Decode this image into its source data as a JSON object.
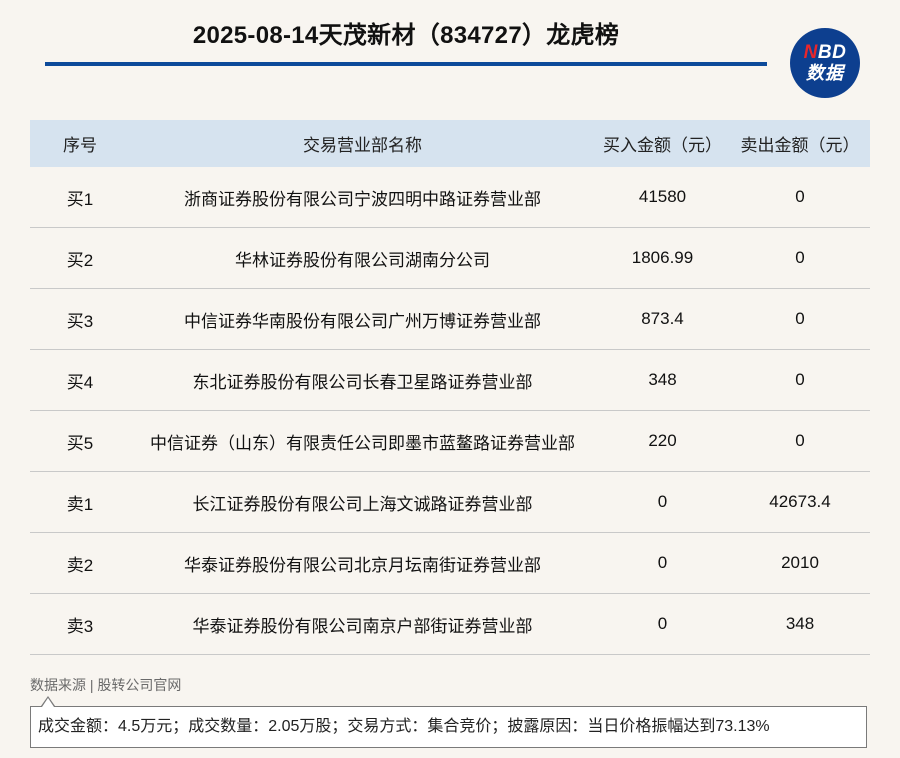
{
  "header": {
    "title": "2025-08-14天茂新材（834727）龙虎榜",
    "logo_line1_accent": "N",
    "logo_line1_rest": "BD",
    "logo_line2": "数据",
    "logo_colors": {
      "background": "#0d3f8f",
      "accent": "#e8262b"
    }
  },
  "table": {
    "columns": [
      "序号",
      "交易营业部名称",
      "买入金额（元）",
      "卖出金额（元）"
    ],
    "rows": [
      {
        "no": "买1",
        "name": "浙商证券股份有限公司宁波四明中路证券营业部",
        "buy": "41580",
        "sell": "0"
      },
      {
        "no": "买2",
        "name": "华林证券股份有限公司湖南分公司",
        "buy": "1806.99",
        "sell": "0"
      },
      {
        "no": "买3",
        "name": "中信证券华南股份有限公司广州万博证券营业部",
        "buy": "873.4",
        "sell": "0"
      },
      {
        "no": "买4",
        "name": "东北证券股份有限公司长春卫星路证券营业部",
        "buy": "348",
        "sell": "0"
      },
      {
        "no": "买5",
        "name": "中信证券（山东）有限责任公司即墨市蓝鳌路证券营业部",
        "buy": "220",
        "sell": "0"
      },
      {
        "no": "卖1",
        "name": "长江证券股份有限公司上海文诚路证券营业部",
        "buy": "0",
        "sell": "42673.4"
      },
      {
        "no": "卖2",
        "name": "华泰证券股份有限公司北京月坛南街证券营业部",
        "buy": "0",
        "sell": "2010"
      },
      {
        "no": "卖3",
        "name": "华泰证券股份有限公司南京户部街证券营业部",
        "buy": "0",
        "sell": "348"
      }
    ]
  },
  "footer": {
    "source": "数据来源 | 股转公司官网",
    "note": "成交金额：4.5万元；成交数量：2.05万股；交易方式：集合竞价；披露原因：当日价格振幅达到73.13%"
  }
}
